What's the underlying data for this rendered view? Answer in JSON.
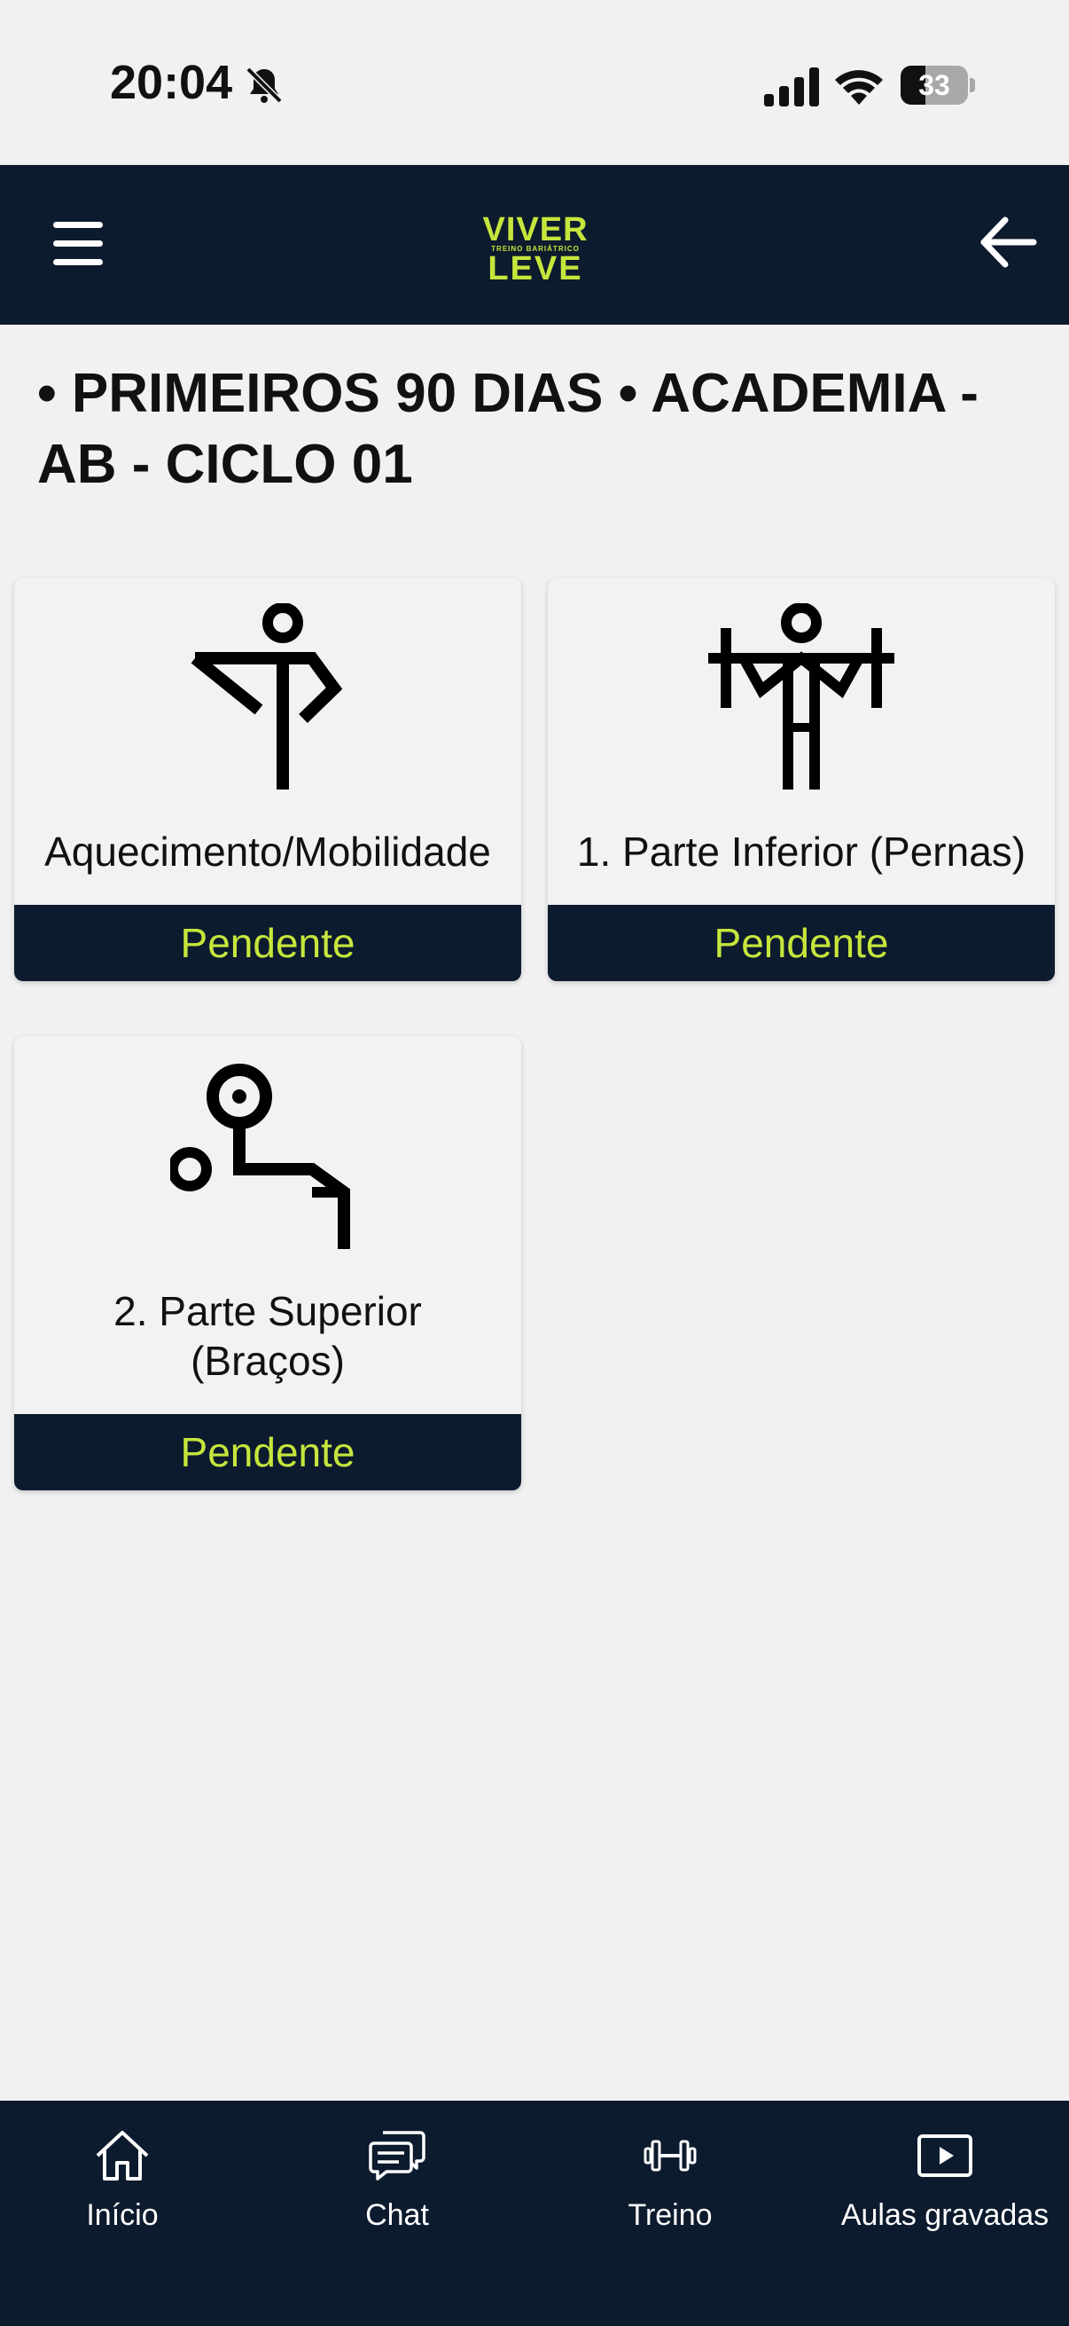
{
  "status_bar": {
    "time": "20:04",
    "battery": "33",
    "icons": [
      "bell-slash-icon",
      "cellular-signal-icon",
      "wifi-icon",
      "battery-icon"
    ]
  },
  "app_bar": {
    "logo_top": "VIVER",
    "logo_tagline": "TREINO BARIÁTRICO",
    "logo_bottom": "LEVE",
    "icons": [
      "hamburger-menu-icon",
      "back-arrow-icon"
    ],
    "colors": {
      "background": "#0d1b2e",
      "accent": "#c6e63c"
    }
  },
  "page": {
    "title": "• PRIMEIROS 90 DIAS • ACADEMIA - AB - CICLO 01"
  },
  "workouts": [
    {
      "label": "Aquecimento/Mobilidade",
      "status": "Pendente",
      "icon": "stretching-icon"
    },
    {
      "label": "1. Parte Inferior (Pernas)",
      "status": "Pendente",
      "icon": "weightlifting-icon"
    },
    {
      "label": "2. Parte Superior (Braços)",
      "status": "Pendente",
      "icon": "bench-press-icon"
    }
  ],
  "tab_bar": {
    "items": [
      {
        "label": "Início",
        "icon": "home-icon"
      },
      {
        "label": "Chat",
        "icon": "chat-icon"
      },
      {
        "label": "Treino",
        "icon": "dumbbell-icon"
      },
      {
        "label": "Aulas gravadas",
        "icon": "play-video-icon"
      }
    ]
  }
}
